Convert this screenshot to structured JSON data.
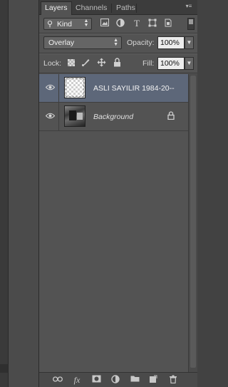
{
  "tabs": [
    {
      "label": "Layers",
      "active": true
    },
    {
      "label": "Channels",
      "active": false
    },
    {
      "label": "Paths",
      "active": false
    }
  ],
  "panel_menu_icon": "panel-menu-icon",
  "filter": {
    "kind_label": "Kind",
    "icons": [
      "pixel-layer-filter-icon",
      "adjustment-filter-icon",
      "type-filter-icon",
      "shape-filter-icon",
      "smart-object-filter-icon"
    ]
  },
  "blend": {
    "mode": "Overlay",
    "opacity_label": "Opacity:",
    "opacity_value": "100%"
  },
  "lock": {
    "label": "Lock:",
    "icons": [
      "lock-transparent-pixels-icon",
      "lock-image-pixels-icon",
      "lock-position-icon",
      "lock-all-icon"
    ],
    "fill_label": "Fill:",
    "fill_value": "100%"
  },
  "layers": [
    {
      "name": "ASLI SAYILIR 1984-20--",
      "selected": true,
      "visible": true,
      "thumbnail": "transparent",
      "locked": false
    },
    {
      "name": "Background",
      "selected": false,
      "visible": true,
      "thumbnail": "photo",
      "locked": true
    }
  ],
  "bottom_icons": [
    "link-layers-icon",
    "add-layer-style-icon",
    "add-mask-icon",
    "new-adjustment-layer-icon",
    "new-group-icon",
    "new-layer-icon",
    "delete-layer-icon"
  ],
  "bottom_glyphs": {
    "fx": "fx"
  },
  "colors": {
    "panel_bg": "#535353",
    "selected_layer": "#5d6779",
    "tab_bar": "#3c3c3c"
  }
}
